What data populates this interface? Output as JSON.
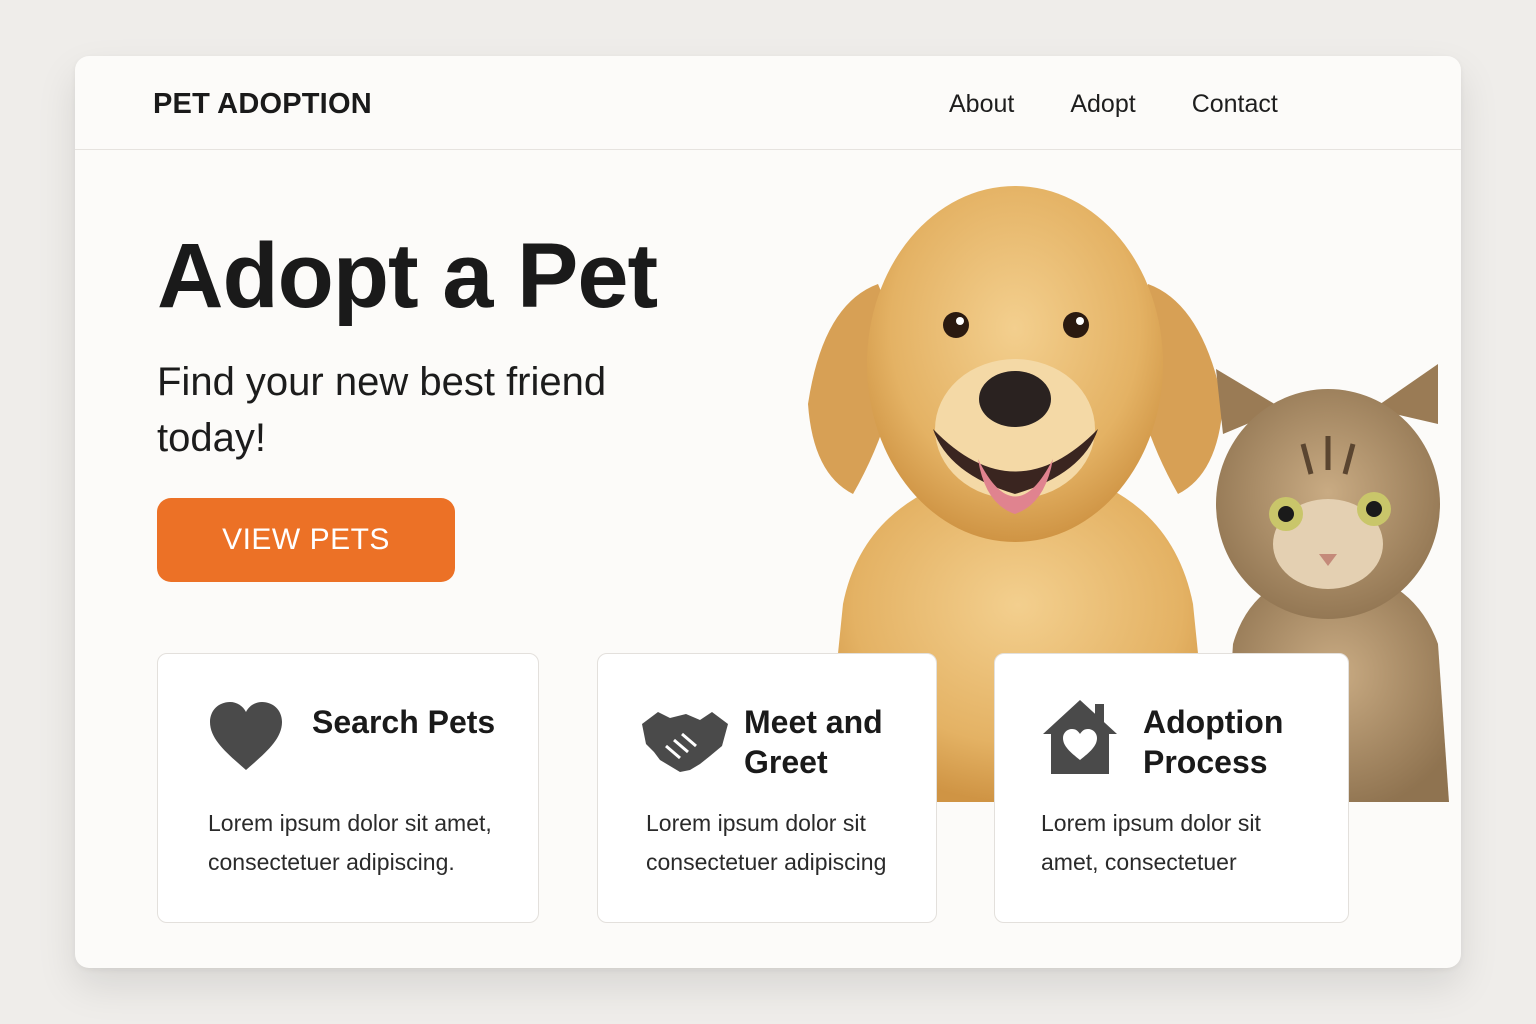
{
  "header": {
    "brand": "PET ADOPTION",
    "nav": [
      "About",
      "Adopt",
      "Contact"
    ]
  },
  "hero": {
    "title": "Adopt a Pet",
    "subtitle": "Find your new best friend today!",
    "cta_label": "VIEW PETS",
    "image_subject": "golden retriever dog and tabby cat"
  },
  "cards": [
    {
      "icon": "heart-icon",
      "title": "Search Pets",
      "description": "Lorem ipsum dolor sit amet, consectetuer adipiscing."
    },
    {
      "icon": "handshake-icon",
      "title": "Meet and Greet",
      "description": "Lorem ipsum dolor sit consectetuer adipiscing"
    },
    {
      "icon": "house-heart-icon",
      "title": "Adoption Process",
      "description": "Lorem ipsum dolor sit amet, consectetuer"
    }
  ],
  "colors": {
    "accent": "#ec7126",
    "background": "#fcfbf9",
    "icon": "#4a4a4a",
    "dog_fur": "#e4b264",
    "cat_fur": "#a48660"
  }
}
